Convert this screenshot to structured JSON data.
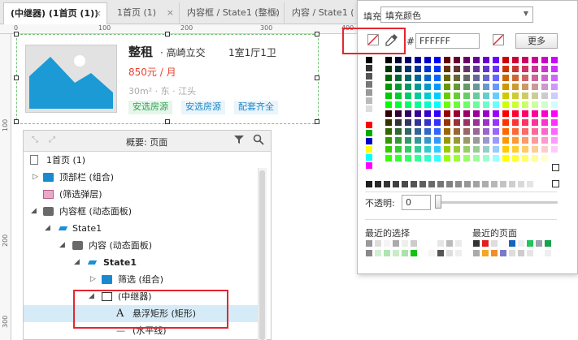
{
  "tabs": [
    {
      "label": "(中继器) (1首页 (1))",
      "close": "×"
    },
    {
      "label": "1首页 (1)",
      "close": "×"
    },
    {
      "label": "内容框 / State1 (整框)",
      "close": "×"
    },
    {
      "label": "内容 / State1 (",
      "close": ""
    }
  ],
  "ruler": {
    "h_marks": [
      "0",
      "100",
      "200",
      "300",
      "400"
    ],
    "v_marks": [
      "100",
      "200",
      "300"
    ]
  },
  "card": {
    "title": "整租",
    "subtitle": "· 高崎立交",
    "layout": "1室1厅1卫",
    "price": "850元 / 月",
    "meta": "30m² · 东 · 江头",
    "tags": [
      "安选房源",
      "安选房源",
      "配套齐全"
    ],
    "colors": {
      "price": "#e8412c",
      "image": "#1b9ad6"
    }
  },
  "outline": {
    "title": "概要: 页面",
    "items": [
      {
        "label": "1首页 (1)"
      },
      {
        "label": "顶部栏 (组合)"
      },
      {
        "label": "(筛选弹层)"
      },
      {
        "label": "内容框 (动态面板)"
      },
      {
        "label": "State1"
      },
      {
        "label": "内容 (动态面板)"
      },
      {
        "label": "State1"
      },
      {
        "label": "筛选 (组合)"
      },
      {
        "label": "(中继器)"
      },
      {
        "label": "悬浮矩形 (矩形)"
      },
      {
        "label": "(水平线)"
      }
    ]
  },
  "picker": {
    "fill_label": "填充",
    "fill_select": "填充颜色",
    "hash": "#",
    "hex_value": "FFFFFF",
    "more_button": "更多",
    "opacity_label": "不透明:",
    "opacity_value": "0",
    "recent_choice": "最近的选择",
    "recent_page": "最近的页面"
  },
  "icons": [
    "search-icon",
    "filter-icon",
    "eyedropper-icon",
    "no-fill-icon",
    "collapse-icon",
    "expand-icon"
  ]
}
